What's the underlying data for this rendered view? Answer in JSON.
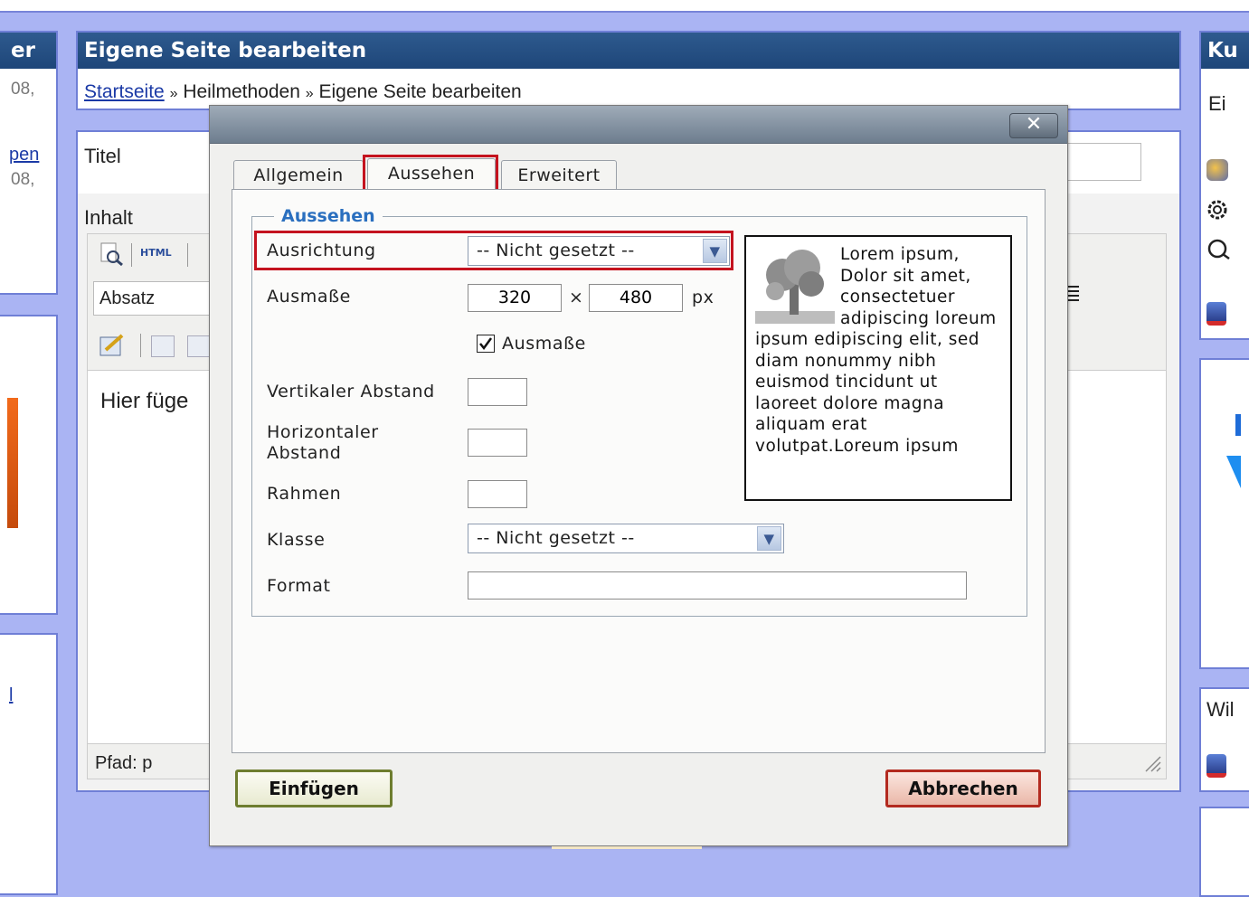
{
  "background": {
    "left_column": {
      "header_fragment": "er",
      "date_fragment_1": "08,",
      "link_fragment": "pen",
      "date_fragment_2": "08,",
      "small_fragment": "l"
    },
    "main_panel": {
      "title": "Eigene Seite bearbeiten",
      "breadcrumb": {
        "home": "Startseite",
        "separator": "»",
        "section": "Heilmethoden",
        "current": "Eigene Seite bearbeiten"
      },
      "title_label": "Titel",
      "content_label": "Inhalt",
      "toolbar": {
        "html_label": "HTML",
        "format_select": "Absatz"
      },
      "editor_text": "Hier füge",
      "status_path": "Pfad: p"
    },
    "right_column": {
      "header_fragment": "Ku",
      "text_fragment": "Ei",
      "bottom_fragment": "Wil"
    }
  },
  "dialog": {
    "close_label": "✕",
    "tabs": [
      {
        "label": "Allgemein",
        "active": false
      },
      {
        "label": "Aussehen",
        "active": true
      },
      {
        "label": "Erweitert",
        "active": false
      }
    ],
    "legend": "Aussehen",
    "fields": {
      "alignment": {
        "label": "Ausrichtung",
        "value": "-- Nicht gesetzt --"
      },
      "dimensions": {
        "label": "Ausmaße",
        "width": "320",
        "times": "×",
        "height": "480",
        "unit": "px"
      },
      "constrain": {
        "label": "Ausmaße",
        "checked": true
      },
      "vspace": {
        "label": "Vertikaler Abstand",
        "value": ""
      },
      "hspace": {
        "label_line1": "Horizontaler",
        "label_line2": "Abstand",
        "value": ""
      },
      "border": {
        "label": "Rahmen",
        "value": ""
      },
      "class": {
        "label": "Klasse",
        "value": "-- Nicht gesetzt --"
      },
      "style": {
        "label": "Format",
        "value": ""
      }
    },
    "preview_text": "Lorem ipsum, Dolor sit amet, consectetuer adipiscing loreum ipsum edipiscing elit, sed diam nonummy nibh euismod tincidunt ut laoreet dolore magna aliquam erat volutpat.Loreum ipsum",
    "buttons": {
      "insert": "Einfügen",
      "cancel": "Abbrechen"
    }
  },
  "colors": {
    "page_bg": "#aab4f3",
    "panel_header": "#1e4679",
    "highlight_red": "#c4131f",
    "legend_blue": "#2a6fbf"
  }
}
